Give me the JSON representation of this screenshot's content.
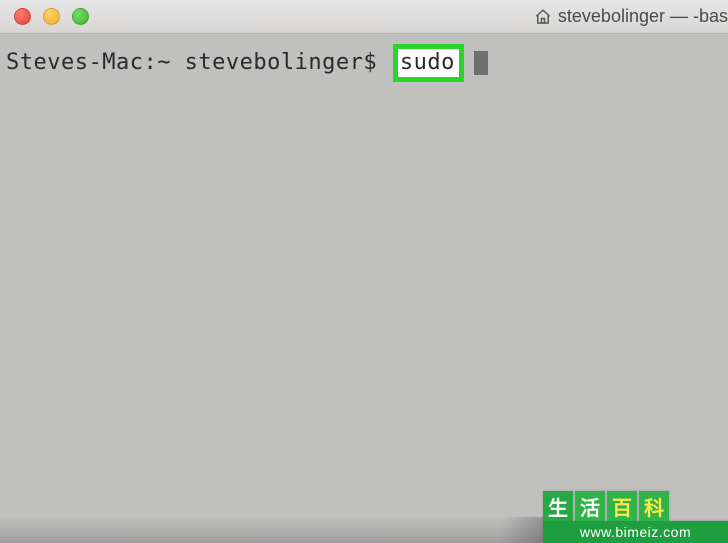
{
  "titlebar": {
    "title": "stevebolinger — -bas",
    "icon": "home-icon"
  },
  "terminal": {
    "prompt": "Steves-Mac:~ stevebolinger$ ",
    "command": "sudo"
  },
  "watermark": {
    "chars": [
      "生",
      "活",
      "百",
      "科"
    ],
    "url": "www.bimeiz.com"
  }
}
